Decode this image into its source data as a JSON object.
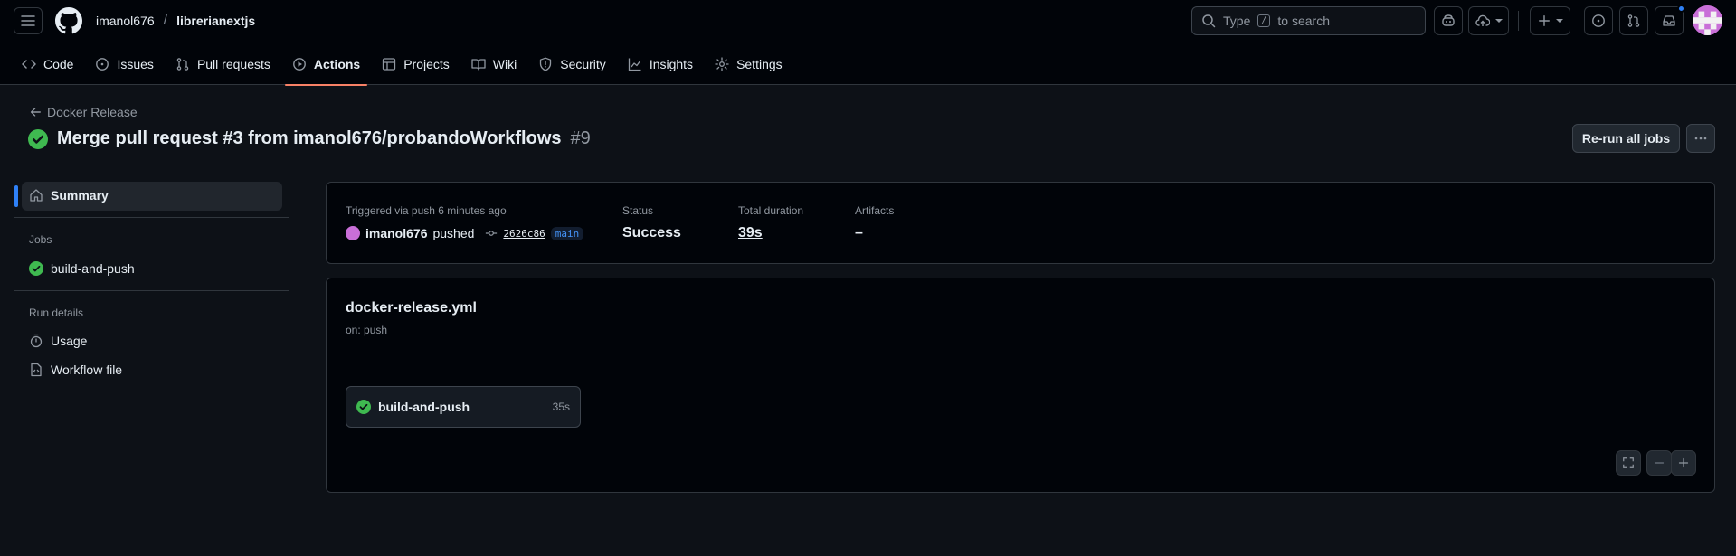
{
  "header": {
    "owner": "imanol676",
    "separator": "/",
    "repo": "librerianextjs",
    "search_prefix": "Type",
    "search_key": "/",
    "search_suffix": "to search"
  },
  "nav": [
    {
      "label": "Code",
      "icon": "code-icon"
    },
    {
      "label": "Issues",
      "icon": "issue-icon"
    },
    {
      "label": "Pull requests",
      "icon": "pull-request-icon"
    },
    {
      "label": "Actions",
      "icon": "play-icon",
      "active": true
    },
    {
      "label": "Projects",
      "icon": "table-icon"
    },
    {
      "label": "Wiki",
      "icon": "book-icon"
    },
    {
      "label": "Security",
      "icon": "shield-icon"
    },
    {
      "label": "Insights",
      "icon": "graph-icon"
    },
    {
      "label": "Settings",
      "icon": "gear-icon"
    }
  ],
  "run": {
    "back_label": "Docker Release",
    "title": "Merge pull request #3 from imanol676/probandoWorkflows",
    "number": "#9",
    "rerun_label": "Re-run all jobs"
  },
  "sidebar": {
    "summary_label": "Summary",
    "jobs_heading": "Jobs",
    "job_label": "build-and-push",
    "run_details_heading": "Run details",
    "usage_label": "Usage",
    "workflow_file_label": "Workflow file"
  },
  "summary": {
    "trigger": "Triggered via push 6 minutes ago",
    "actor": "imanol676",
    "action": "pushed",
    "sha": "2626c86",
    "branch": "main",
    "status_label": "Status",
    "status_value": "Success",
    "duration_label": "Total duration",
    "duration_value": "39s",
    "artifacts_label": "Artifacts",
    "artifacts_value": "–"
  },
  "workflow": {
    "file": "docker-release.yml",
    "on": "on: push",
    "job_name": "build-and-push",
    "job_duration": "35s"
  },
  "colors": {
    "success": "#3fb950",
    "accent": "#f78166",
    "link": "#4493f8",
    "background": "#0d1117"
  }
}
